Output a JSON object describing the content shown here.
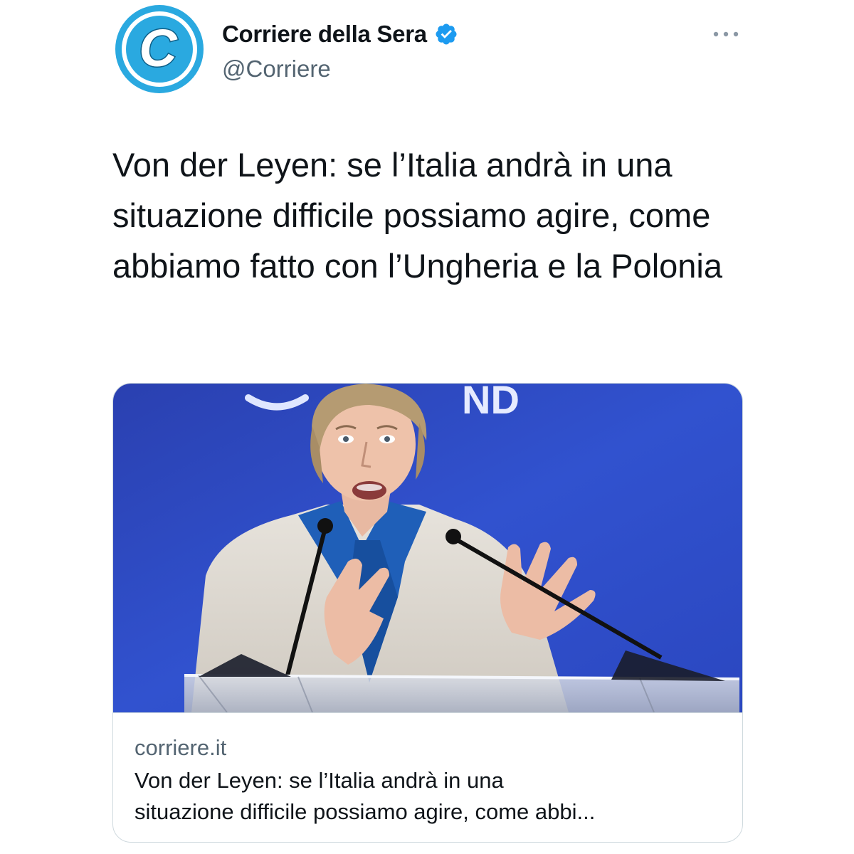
{
  "account": {
    "display_name": "Corriere della Sera",
    "handle": "@Corriere",
    "avatar_letter": "C",
    "verified": true,
    "avatar_icon": "corriere-logo-icon",
    "verified_icon": "verified-badge-icon",
    "more_icon": "more-options-icon"
  },
  "tweet": {
    "text": "Von der Leyen: se l’Italia andrà in una situazione difficile possiamo agire, come abbiamo fatto con l’Ungheria e la Polonia"
  },
  "card": {
    "image_backdrop_text": "ND",
    "domain": "corriere.it",
    "title": "Von der Leyen: se l’Italia andrà in una\nsituazione difficile possiamo agire, come abbi..."
  },
  "colors": {
    "brand_blue": "#2aa9e0",
    "verified_blue": "#1d9bf0",
    "text_primary": "#0f1419",
    "text_secondary": "#536471",
    "border": "#cfd9de",
    "stage_blue": "#2f4dc6"
  }
}
